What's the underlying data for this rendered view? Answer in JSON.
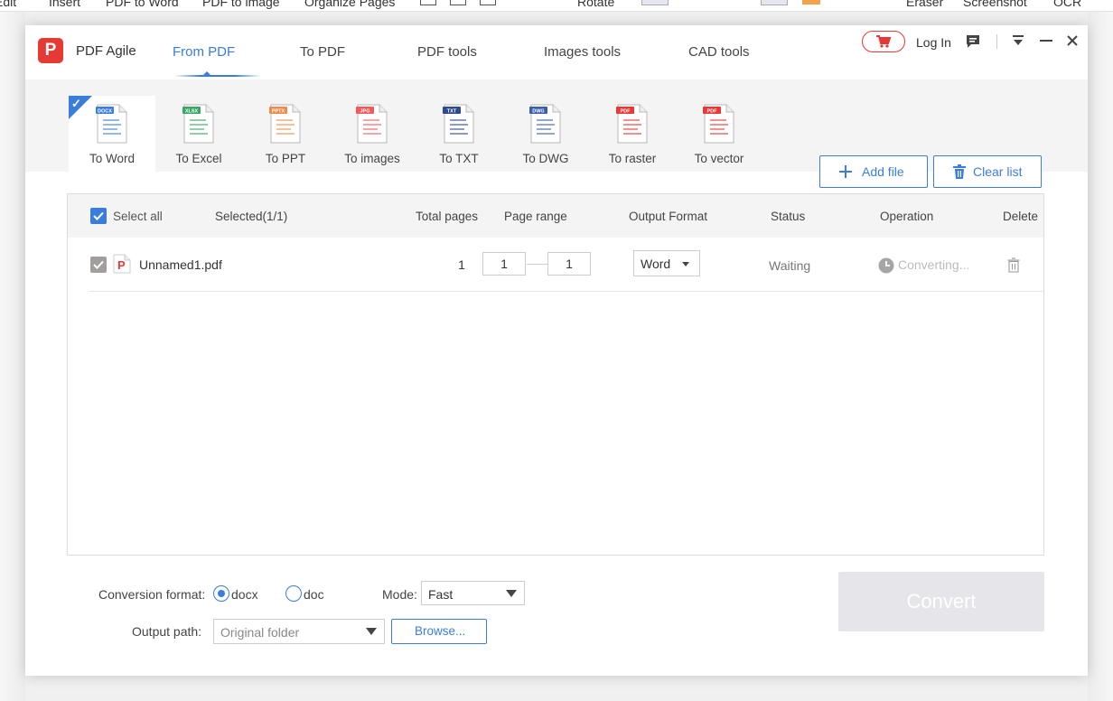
{
  "background_toolbar": {
    "items": [
      "Edit",
      "Insert",
      "PDF to Word",
      "PDF to image",
      "Organize Pages",
      "Rotate",
      "Eraser",
      "Screenshot",
      "OCR"
    ]
  },
  "header": {
    "app_name": "PDF Agile",
    "logo_letter": "P",
    "tabs": [
      "From PDF",
      "To PDF",
      "PDF tools",
      "Images tools",
      "CAD tools"
    ],
    "active_tab": "From PDF",
    "login": "Log In"
  },
  "tools": {
    "items": [
      {
        "label": "To Word",
        "badge": "DOCX",
        "color": "#3b7ddd"
      },
      {
        "label": "To Excel",
        "badge": "XLSX",
        "color": "#3aa565"
      },
      {
        "label": "To PPT",
        "badge": "PPTX",
        "color": "#f08a4b"
      },
      {
        "label": "To images",
        "badge": "JPG",
        "color": "#ef5b5b"
      },
      {
        "label": "To TXT",
        "badge": "TXT",
        "color": "#2e4a8f"
      },
      {
        "label": "To DWG",
        "badge": "DWG",
        "color": "#3a5fa8"
      },
      {
        "label": "To raster",
        "badge": "PDF",
        "color": "#e53935"
      },
      {
        "label": "To vector",
        "badge": "PDF",
        "color": "#e53935"
      }
    ],
    "selected": "To Word",
    "add_file": "Add file",
    "clear_list": "Clear list"
  },
  "table": {
    "select_all": "Select all",
    "headers": {
      "selected": "Selected(1/1)",
      "total_pages": "Total pages",
      "page_range": "Page range",
      "output_format": "Output Format",
      "status": "Status",
      "operation": "Operation",
      "delete": "Delete"
    },
    "rows": [
      {
        "file_name": "Unnamed1.pdf",
        "total_pages": "1",
        "range_from": "1",
        "range_to": "1",
        "output_format": "Word",
        "status": "Waiting",
        "operation": "Converting..."
      }
    ]
  },
  "options": {
    "conversion_format_label": "Conversion format:",
    "formats": [
      "docx",
      "doc"
    ],
    "selected_format": "docx",
    "mode_label": "Mode:",
    "mode_value": "Fast",
    "output_path_label": "Output path:",
    "output_path_placeholder": "Original folder",
    "browse": "Browse...",
    "convert": "Convert"
  },
  "colors": {
    "accent": "#3b7ddd",
    "brand_red": "#e53935"
  }
}
